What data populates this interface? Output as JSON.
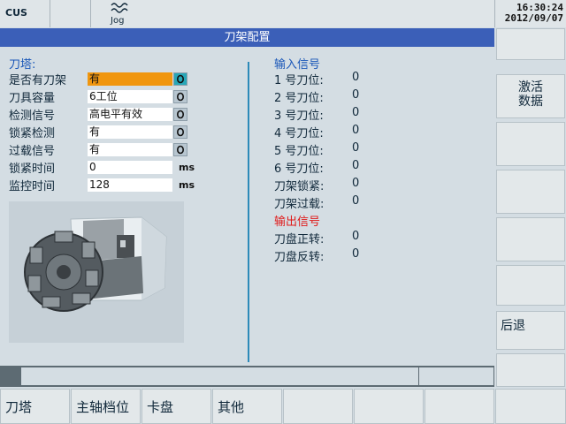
{
  "header": {
    "mode": "CUS",
    "op_mode": "Jog",
    "time": "16:30:24",
    "date": "2012/09/07"
  },
  "title": "刀架配置",
  "turret": {
    "section_title": "刀塔:",
    "rows": [
      {
        "label": "是否有刀架",
        "value": "有"
      },
      {
        "label": "刀具容量",
        "value": "6工位"
      },
      {
        "label": "检测信号",
        "value": "高电平有效"
      },
      {
        "label": "锁紧检测",
        "value": "有"
      },
      {
        "label": "过载信号",
        "value": "有"
      },
      {
        "label": "锁紧时间",
        "value": "0",
        "unit": "ms"
      },
      {
        "label": "监控时间",
        "value": "128",
        "unit": "ms"
      }
    ]
  },
  "inputs": {
    "title": "输入信号",
    "rows": [
      {
        "label": "1 号刀位:",
        "value": "0"
      },
      {
        "label": "2 号刀位:",
        "value": "0"
      },
      {
        "label": "3 号刀位:",
        "value": "0"
      },
      {
        "label": "4 号刀位:",
        "value": "0"
      },
      {
        "label": "5 号刀位:",
        "value": "0"
      },
      {
        "label": "6 号刀位:",
        "value": "0"
      },
      {
        "label": "刀架锁紧:",
        "value": "0"
      },
      {
        "label": "刀架过载:",
        "value": "0"
      }
    ]
  },
  "outputs": {
    "title": "输出信号",
    "rows": [
      {
        "label": "刀盘正转:",
        "value": "0"
      },
      {
        "label": "刀盘反转:",
        "value": "0"
      }
    ]
  },
  "softkeys_v": {
    "activate_line1": "激活",
    "activate_line2": "数据",
    "back": "后退"
  },
  "softkeys_h": [
    "刀塔",
    "主轴档位",
    "卡盘",
    "其他"
  ],
  "colors": {
    "title_bar": "#3b5fb8",
    "selected_field": "#f0960f",
    "output_title": "#e01a1a",
    "section_title": "#1a57b8"
  }
}
